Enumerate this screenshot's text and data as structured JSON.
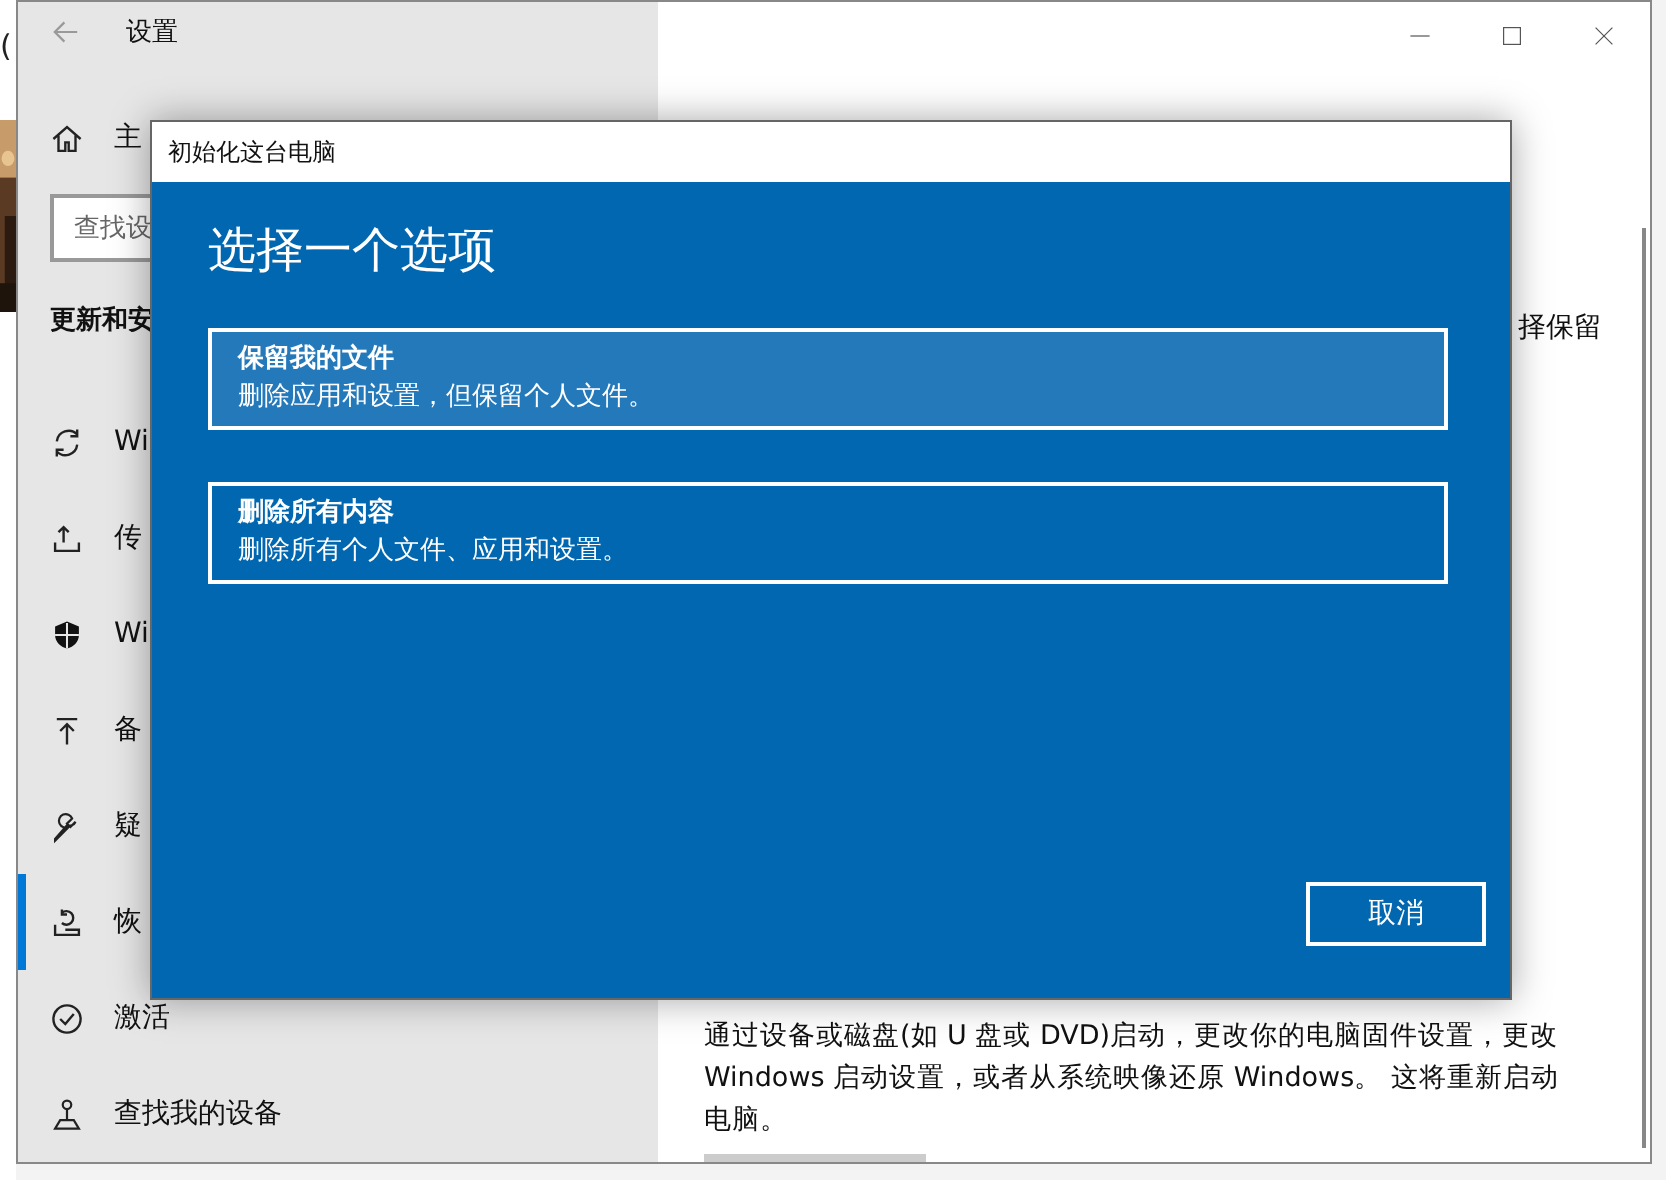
{
  "background_window": {
    "fragment": "("
  },
  "window": {
    "title": "设置"
  },
  "sidebar": {
    "home": "主",
    "search": {
      "placeholder": "查找设"
    },
    "section": "更新和安",
    "items": [
      {
        "kind": "sync",
        "label": "Wi",
        "selected": false
      },
      {
        "kind": "delivery",
        "label": "传",
        "selected": false
      },
      {
        "kind": "security",
        "label": "Wi",
        "selected": false
      },
      {
        "kind": "backup",
        "label": "备",
        "selected": false
      },
      {
        "kind": "troubleshoot",
        "label": "疑",
        "selected": false
      },
      {
        "kind": "recovery",
        "label": "恢",
        "selected": true
      },
      {
        "kind": "activation",
        "label": "激活",
        "selected": false
      },
      {
        "kind": "find-device",
        "label": "查找我的设备",
        "selected": false
      }
    ]
  },
  "content": {
    "fragment": "择保留",
    "description": "通过设备或磁盘(如 U 盘或 DVD)启动，更改你的电脑固件设置，更改 Windows 启动设置，或者从系统映像还原 Windows。 这将重新启动电脑。"
  },
  "dialog": {
    "title": "初始化这台电脑",
    "heading": "选择一个选项",
    "options": [
      {
        "title": "保留我的文件",
        "description": "删除应用和设置，但保留个人文件。",
        "selected": true
      },
      {
        "title": "删除所有内容",
        "description": "删除所有个人文件、应用和设置。",
        "selected": false
      }
    ],
    "cancel": "取消"
  }
}
